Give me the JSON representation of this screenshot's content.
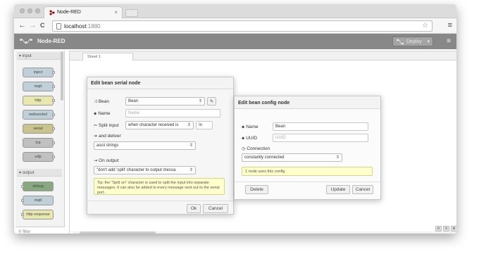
{
  "browser": {
    "tab_title": "Node-RED",
    "tab_close": "×",
    "nav": {
      "back": "←",
      "forward": "→",
      "reload": "C"
    },
    "url_host": "localhost",
    "url_port": ":1880",
    "star": "☆",
    "menu": "≡"
  },
  "app": {
    "title": "Node-RED",
    "deploy_label": "Deploy",
    "deploy_caret": "▾",
    "menu": "≡"
  },
  "palette": {
    "categories": [
      {
        "label": "▾ input"
      },
      {
        "label": "▾ output"
      }
    ],
    "input_nodes": [
      "inject",
      "mqtt",
      "http",
      "websocket",
      "serial",
      "tcp",
      "udp"
    ],
    "output_nodes": [
      "debug",
      "mqtt",
      "http response"
    ],
    "filter_placeholder": "filter"
  },
  "workspace": {
    "tab": "Sheet 1",
    "add": "+",
    "zoom": [
      "⊖",
      "⊙",
      "⊕"
    ]
  },
  "serial_dialog": {
    "title": "Edit bean serial node",
    "bean_label": "Bean",
    "bean_value": "Bean",
    "bean_edit": "✎",
    "name_label": "Name",
    "name_placeholder": "Name",
    "split_label": "Split input",
    "split_value": "when character received is",
    "split_char": "\\n",
    "deliver_label": "and deliver",
    "deliver_value": "ascii strings",
    "output_label": "On output",
    "output_value": "\"don't add 'split' character to output messa",
    "tip": "Tip: the \"Split on\" character is used to split the input into separate messages. It can also be added to every message sent out to the serial port.",
    "ok": "Ok",
    "cancel": "Cancel"
  },
  "config_dialog": {
    "title": "Edit bean config node",
    "name_label": "Name",
    "name_value": "Bean",
    "uuid_label": "UUID",
    "uuid_placeholder": "UUID",
    "connection_label": "Connection",
    "connection_value": "constantly connected",
    "usage": "1 node uses this config",
    "delete": "Delete",
    "update": "Update",
    "cancel": "Cancel"
  },
  "colors": {
    "nr_header": "#888888",
    "input_node": "#c0d0d8",
    "node_mqtt": "#d7d7a0",
    "node_http": "#e7e7ae",
    "node_serial": "#c8c48c",
    "node_tcp": "#c0c0c0",
    "node_debug": "#87a980",
    "tip_bg": "#ffffcc"
  }
}
